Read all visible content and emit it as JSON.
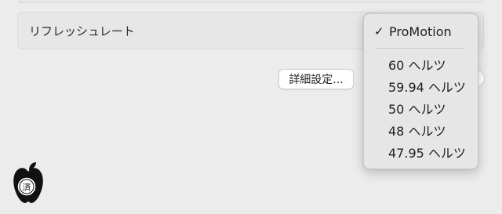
{
  "settings": {
    "refresh_rate_label": "リフレッシュレート",
    "advanced_button_label": "詳細設定...",
    "help_button_label": "?"
  },
  "refresh_menu": {
    "selected": "ProMotion",
    "check_mark": "✓",
    "options": [
      "ProMotion",
      "60 ヘルツ",
      "59.94 ヘルツ",
      "50 ヘルツ",
      "48 ヘルツ",
      "47.95 ヘルツ"
    ]
  },
  "watermark": {
    "text": "済",
    "icon": "apple-logo-icon"
  }
}
